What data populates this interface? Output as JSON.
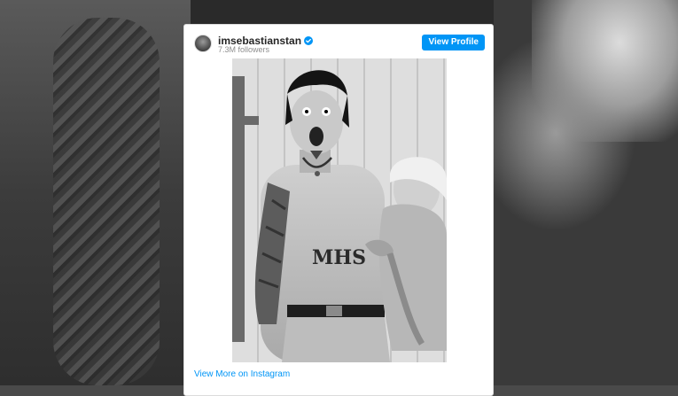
{
  "embed": {
    "username": "imsebastianstan",
    "followers": "7.3M followers",
    "view_profile_label": "View Profile",
    "view_more_label": "View More on Instagram",
    "photo_tattoo_text": "MHS"
  },
  "colors": {
    "accent": "#0095f6",
    "card_background": "#ffffff",
    "username_text": "#262626",
    "muted_text": "#8e8e8e"
  },
  "icons": [
    "avatar",
    "verified-badge-icon"
  ]
}
